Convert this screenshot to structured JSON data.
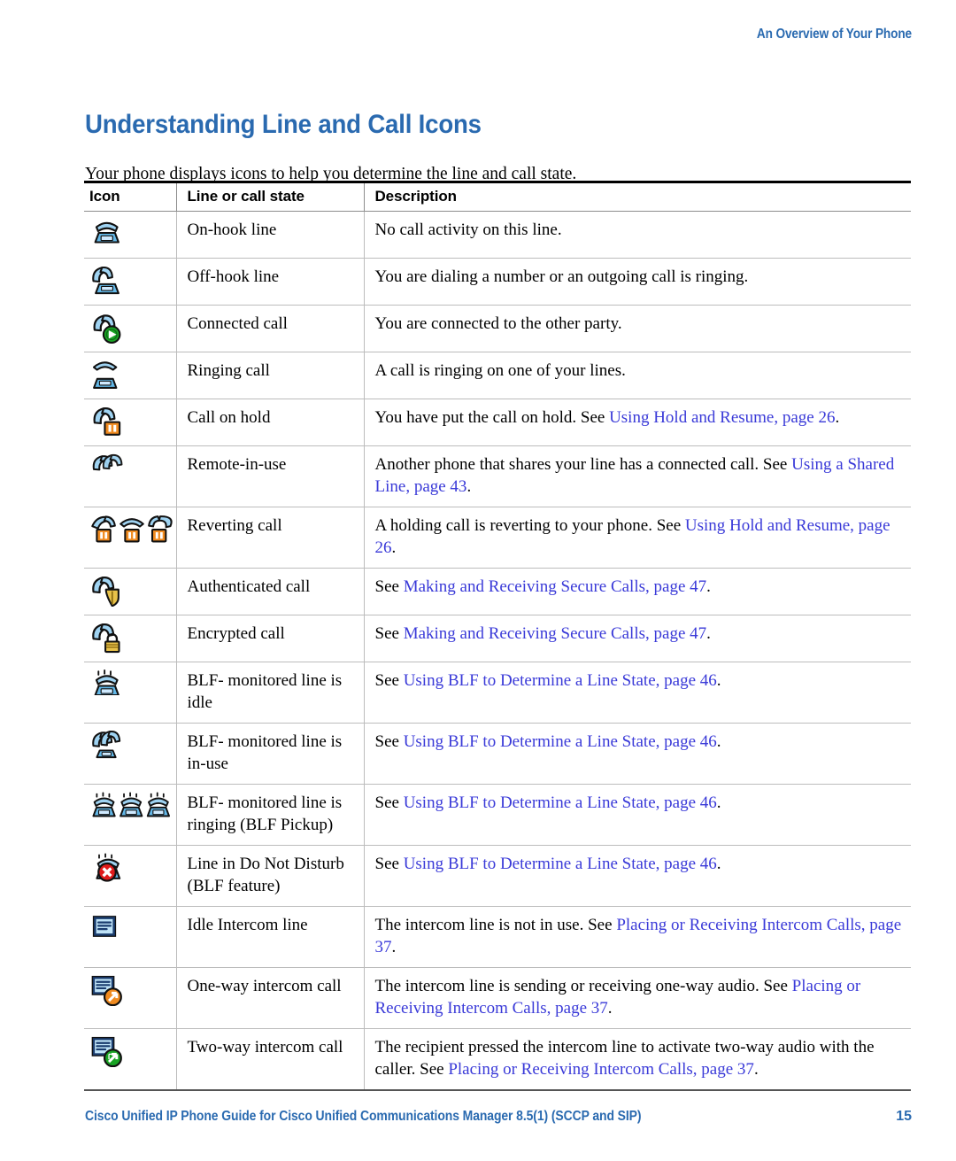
{
  "header": {
    "running_head": "An Overview of Your Phone"
  },
  "title": "Understanding Line and Call Icons",
  "intro": "Your phone displays icons to help you determine the line and call state.",
  "table": {
    "columns": [
      "Icon",
      "Line or call state",
      "Description"
    ],
    "rows": [
      {
        "icon": "on-hook-line-icon",
        "state": "On-hook line",
        "desc_parts": [
          {
            "text": "No call activity on this line.",
            "link": false
          }
        ]
      },
      {
        "icon": "off-hook-line-icon",
        "state": "Off-hook line",
        "desc_parts": [
          {
            "text": "You are dialing a number or an outgoing call is ringing.",
            "link": false
          }
        ]
      },
      {
        "icon": "connected-call-icon",
        "state": "Connected call",
        "desc_parts": [
          {
            "text": "You are connected to the other party.",
            "link": false
          }
        ]
      },
      {
        "icon": "ringing-call-icon",
        "state": "Ringing call",
        "desc_parts": [
          {
            "text": "A call is ringing on one of your lines.",
            "link": false
          }
        ]
      },
      {
        "icon": "call-on-hold-icon",
        "state": "Call on hold",
        "desc_parts": [
          {
            "text": "You have put the call on hold. See ",
            "link": false
          },
          {
            "text": "Using Hold and Resume, page 26",
            "link": true
          },
          {
            "text": ".",
            "link": false
          }
        ]
      },
      {
        "icon": "remote-in-use-icon",
        "state": "Remote-in-use",
        "desc_parts": [
          {
            "text": "Another phone that shares your line has a connected call. See ",
            "link": false
          },
          {
            "text": "Using a Shared Line, page 43",
            "link": true
          },
          {
            "text": ".",
            "link": false
          }
        ]
      },
      {
        "icon": "reverting-call-icon",
        "state": "Reverting call",
        "desc_parts": [
          {
            "text": "A holding call is reverting to your phone. See ",
            "link": false
          },
          {
            "text": "Using Hold and Resume, page 26",
            "link": true
          },
          {
            "text": ".",
            "link": false
          }
        ]
      },
      {
        "icon": "authenticated-call-icon",
        "state": "Authenticated call",
        "desc_parts": [
          {
            "text": "See ",
            "link": false
          },
          {
            "text": "Making and Receiving Secure Calls, page 47",
            "link": true
          },
          {
            "text": ".",
            "link": false
          }
        ]
      },
      {
        "icon": "encrypted-call-icon",
        "state": "Encrypted call",
        "desc_parts": [
          {
            "text": "See ",
            "link": false
          },
          {
            "text": "Making and Receiving Secure Calls, page 47",
            "link": true
          },
          {
            "text": ".",
            "link": false
          }
        ]
      },
      {
        "icon": "blf-idle-line-icon",
        "state": "BLF- monitored line is idle",
        "desc_parts": [
          {
            "text": "See ",
            "link": false
          },
          {
            "text": "Using BLF to Determine a Line State, page 46",
            "link": true
          },
          {
            "text": ".",
            "link": false
          }
        ]
      },
      {
        "icon": "blf-in-use-line-icon",
        "state": "BLF- monitored line is in-use",
        "desc_parts": [
          {
            "text": "See ",
            "link": false
          },
          {
            "text": "Using BLF to Determine a Line State, page 46",
            "link": true
          },
          {
            "text": ".",
            "link": false
          }
        ]
      },
      {
        "icon": "blf-ringing-line-icon",
        "state": "BLF- monitored line is ringing (BLF Pickup)",
        "desc_parts": [
          {
            "text": "See ",
            "link": false
          },
          {
            "text": "Using BLF to Determine a Line State, page 46",
            "link": true
          },
          {
            "text": ".",
            "link": false
          }
        ]
      },
      {
        "icon": "do-not-disturb-line-icon",
        "state": "Line in Do Not Disturb (BLF feature)",
        "desc_parts": [
          {
            "text": "See ",
            "link": false
          },
          {
            "text": "Using BLF to Determine a Line State, page 46",
            "link": true
          },
          {
            "text": ".",
            "link": false
          }
        ]
      },
      {
        "icon": "idle-intercom-line-icon",
        "state": "Idle Intercom line",
        "desc_parts": [
          {
            "text": "The intercom line is not in use. See ",
            "link": false
          },
          {
            "text": "Placing or Receiving Intercom Calls, page 37",
            "link": true
          },
          {
            "text": ".",
            "link": false
          }
        ]
      },
      {
        "icon": "one-way-intercom-call-icon",
        "state": "One-way intercom call",
        "desc_parts": [
          {
            "text": "The intercom line is sending or receiving one-way audio. See ",
            "link": false
          },
          {
            "text": "Placing or Receiving Intercom Calls, page 37",
            "link": true
          },
          {
            "text": ".",
            "link": false
          }
        ]
      },
      {
        "icon": "two-way-intercom-call-icon",
        "state": "Two-way intercom call",
        "desc_parts": [
          {
            "text": "The recipient pressed the intercom line to activate two-way audio with the caller. See ",
            "link": false
          },
          {
            "text": "Placing or Receiving Intercom Calls, page 37",
            "link": true
          },
          {
            "text": ".",
            "link": false
          }
        ]
      }
    ]
  },
  "footer": {
    "text": "Cisco Unified IP Phone Guide for Cisco Unified Communications Manager 8.5(1) (SCCP and SIP)",
    "page_number": "15"
  },
  "colors": {
    "heading_blue": "#2a6ab0",
    "link_blue": "#3a3ad8",
    "rule_black": "#000000",
    "rule_gray": "#bcbcbc"
  }
}
